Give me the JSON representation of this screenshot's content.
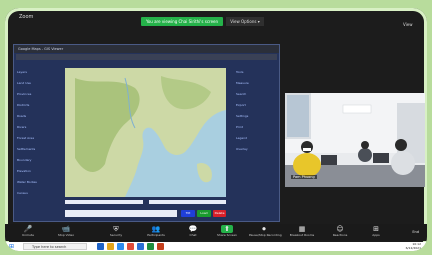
{
  "zoom": {
    "app_title": "Zoom",
    "share_banner": "You are viewing Chai Sirithi's screen",
    "view_options_label": "View Options ▾",
    "view_label": "View"
  },
  "app_window": {
    "title": "Google Maps - GIS Viewer",
    "left_panel_items": [
      "Layers",
      "Land Use",
      "Provinces",
      "Districts",
      "Roads",
      "Rivers",
      "Forest Area",
      "Settlements",
      "Boundary",
      "Elevation",
      "Water Bodies",
      "Census"
    ],
    "right_panel_items": [
      "Tools",
      "Measure",
      "Search",
      "Export",
      "Settings",
      "Print",
      "Legend",
      "Overlay"
    ],
    "buttons": [
      "Tilt",
      "Load",
      "Delete"
    ],
    "button_colors": [
      "#1f3fd8",
      "#1a9c2e",
      "#d8202a"
    ],
    "status": "Lat 13.72 Lon 100.52"
  },
  "video": {
    "participant_name": "Pam Phuong"
  },
  "toolbar": {
    "items": [
      {
        "icon": "microphone-icon",
        "glyph": "🎤",
        "label": "Unmute"
      },
      {
        "icon": "video-camera-icon",
        "glyph": "📹",
        "label": "Stop Video"
      },
      {
        "icon": "shield-icon",
        "glyph": "⛨",
        "label": "Security"
      },
      {
        "icon": "participants-icon",
        "glyph": "👥",
        "label": "Participants"
      },
      {
        "icon": "chat-icon",
        "glyph": "💬",
        "label": "Chat"
      },
      {
        "icon": "share-screen-icon",
        "glyph": "⬆",
        "label": "Share Screen"
      },
      {
        "icon": "record-icon",
        "glyph": "⏺",
        "label": "Pause/Stop Recording"
      },
      {
        "icon": "breakout-rooms-icon",
        "glyph": "▦",
        "label": "Breakout Rooms"
      },
      {
        "icon": "reactions-icon",
        "glyph": "☺",
        "label": "Reactions"
      },
      {
        "icon": "apps-icon",
        "glyph": "⊞",
        "label": "Apps"
      }
    ],
    "end_label": "End"
  },
  "taskbar": {
    "search_placeholder": "Type here to search",
    "time": "10:12",
    "date": "6/12/2021"
  }
}
